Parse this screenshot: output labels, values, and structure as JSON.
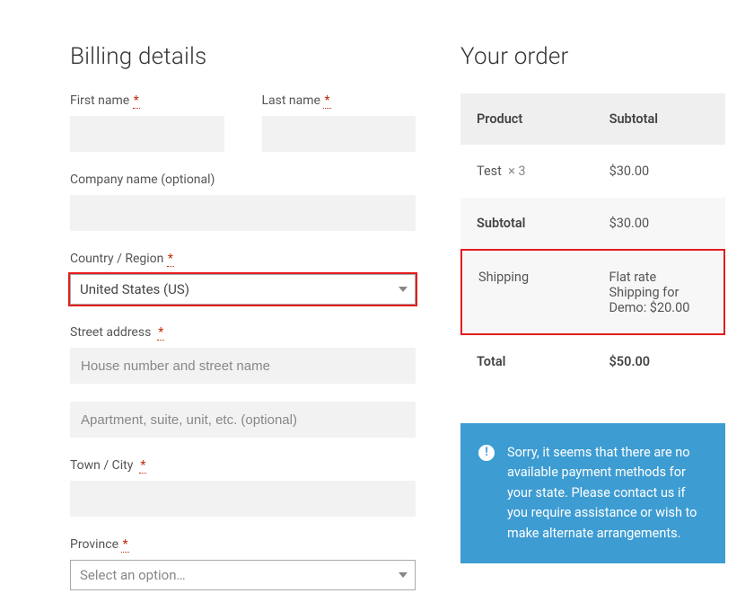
{
  "billing": {
    "heading": "Billing details",
    "first_name_label": "First name",
    "last_name_label": "Last name",
    "company_label": "Company name (optional)",
    "country_label": "Country / Region",
    "country_value": "United States (US)",
    "street_label": "Street address",
    "street_placeholder": "House number and street name",
    "street2_placeholder": "Apartment, suite, unit, etc. (optional)",
    "city_label": "Town / City",
    "province_label": "Province",
    "province_placeholder": "Select an option…",
    "required_mark": "*"
  },
  "order": {
    "heading": "Your order",
    "col_product": "Product",
    "col_subtotal": "Subtotal",
    "item_name": "Test",
    "item_qty": "× 3",
    "item_price": "$30.00",
    "subtotal_label": "Subtotal",
    "subtotal_value": "$30.00",
    "shipping_label": "Shipping",
    "shipping_value": "Flat rate Shipping for Demo: $20.00",
    "total_label": "Total",
    "total_value": "$50.00"
  },
  "notice": {
    "icon": "!",
    "text": "Sorry, it seems that there are no available payment methods for your state. Please contact us if you require assistance or wish to make alternate arrangements."
  }
}
